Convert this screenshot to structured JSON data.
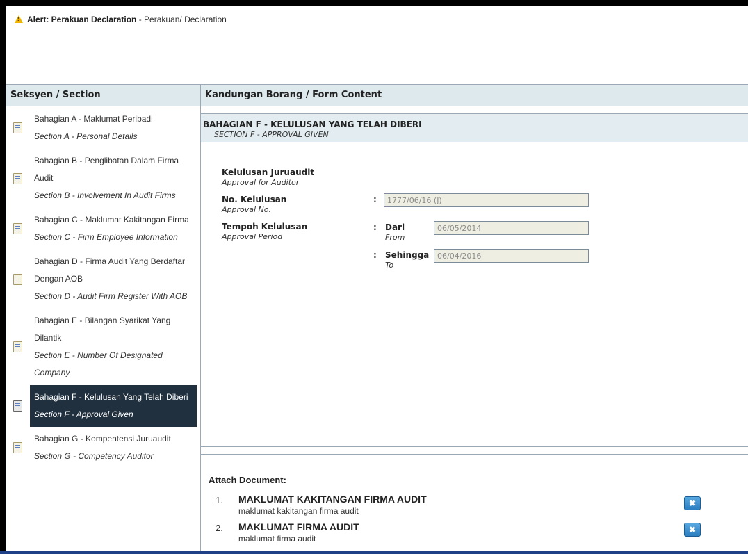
{
  "alert": {
    "title": "Alert: Perakuan Declaration",
    "text": " - Perakuan/ Declaration",
    "icon": "warning-icon"
  },
  "sidebar": {
    "header": "Seksyen / Section",
    "items": [
      {
        "ms": "Bahagian A - Maklumat Peribadi",
        "en": "Section A - Personal Details",
        "active": false
      },
      {
        "ms": "Bahagian B - Penglibatan Dalam Firma Audit",
        "en": "Section B - Involvement In Audit Firms",
        "active": false
      },
      {
        "ms": "Bahagian C - Maklumat Kakitangan Firma",
        "en": "Section C - Firm Employee Information",
        "active": false
      },
      {
        "ms": "Bahagian D - Firma Audit Yang Berdaftar Dengan AOB",
        "en": "Section D - Audit Firm Register With AOB",
        "active": false
      },
      {
        "ms": "Bahagian E - Bilangan Syarikat Yang Dilantik",
        "en": "Section E - Number Of Designated Company",
        "active": false
      },
      {
        "ms": "Bahagian F - Kelulusan Yang Telah Diberi",
        "en": "Section F - Approval Given",
        "active": true
      },
      {
        "ms": "Bahagian G - Kompentensi Juruaudit",
        "en": "Section G - Competency Auditor",
        "active": false
      }
    ]
  },
  "form": {
    "header": "Kandungan Borang / Form Content",
    "section_title_ms": "BAHAGIAN F - KELULUSAN YANG TELAH DIBERI",
    "section_title_en": "SECTION F - APPROVAL GIVEN",
    "approval_auditor_ms": "Kelulusan Juruaudit",
    "approval_auditor_en": "Approval for Auditor",
    "approval_no_ms": "No. Kelulusan",
    "approval_no_en": "Approval No.",
    "approval_no_value": "1777/06/16 (J)",
    "period_ms": "Tempoh Kelulusan",
    "period_en": "Approval Period",
    "from_ms": "Dari",
    "from_en": "From",
    "from_value": "06/05/2014",
    "to_ms": "Sehingga",
    "to_en": "To",
    "to_value": "06/04/2016",
    "colon": ":"
  },
  "attach": {
    "title": "Attach Document:",
    "items": [
      {
        "num": "1.",
        "name": "MAKLUMAT KAKITANGAN FIRMA AUDIT",
        "desc": "maklumat kakitangan firma audit",
        "delete_label": "✖"
      },
      {
        "num": "2.",
        "name": "MAKLUMAT FIRMA AUDIT",
        "desc": "maklumat firma audit",
        "delete_label": "✖"
      }
    ]
  },
  "colors": {
    "header_bg": "#dde9ed",
    "active_bg": "#21303f",
    "button_blue": "#2a7ec0",
    "field_bg": "#efeee3"
  }
}
